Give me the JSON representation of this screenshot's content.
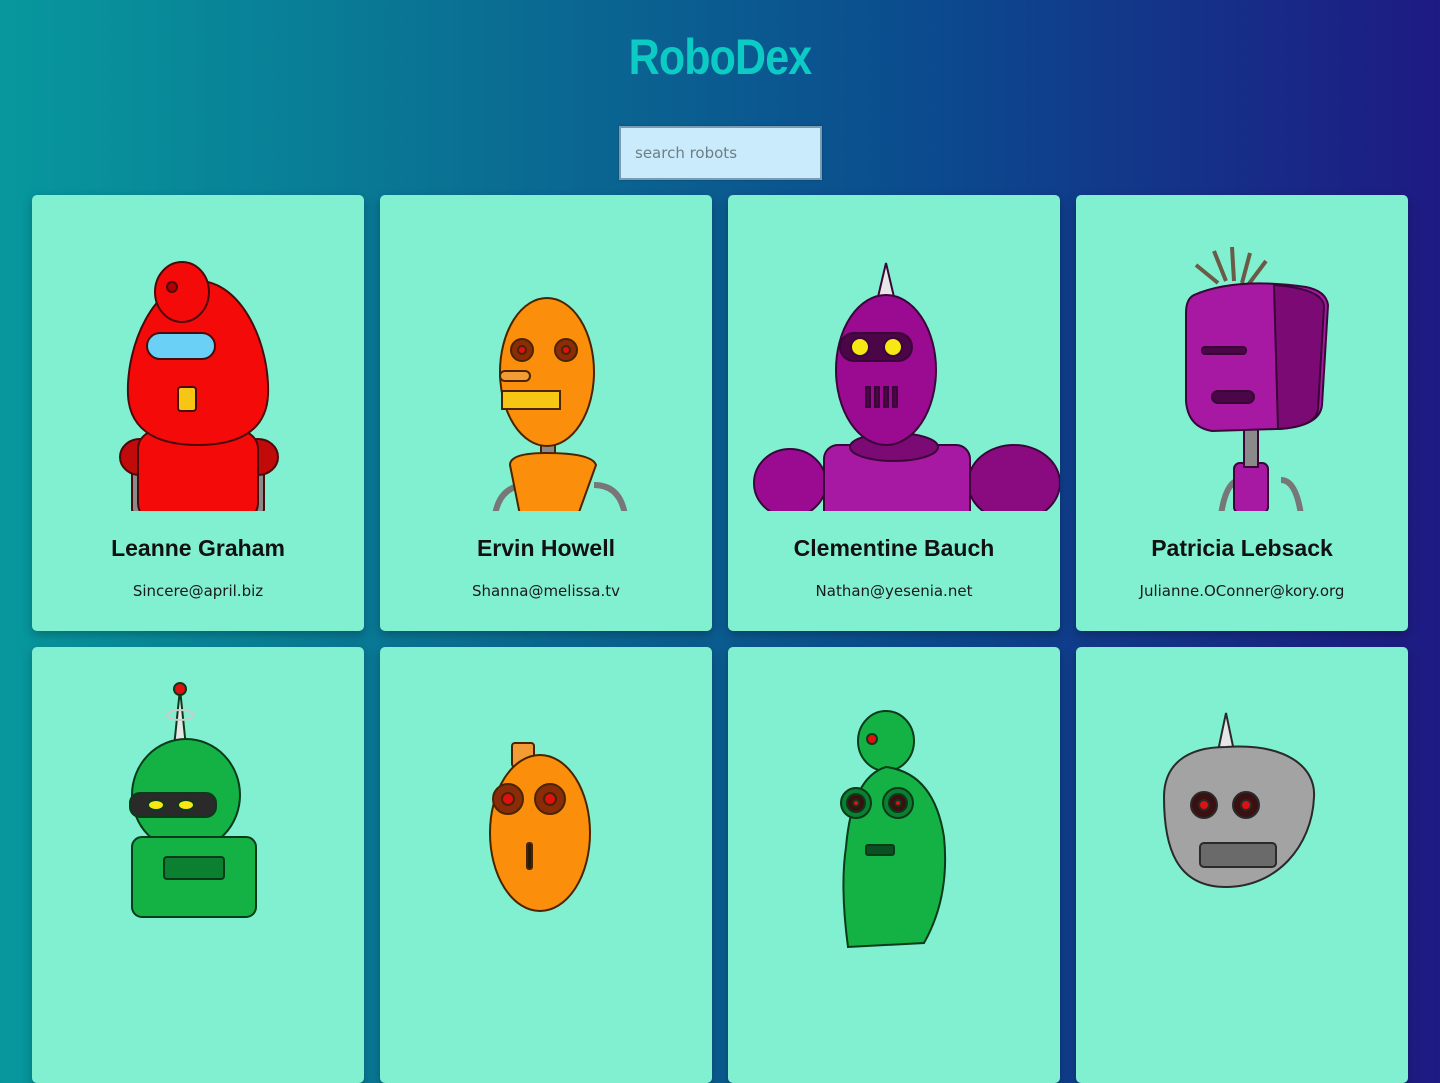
{
  "app": {
    "title": "RoboDex"
  },
  "search": {
    "placeholder": "search robots",
    "value": ""
  },
  "robots": [
    {
      "name": "Leanne Graham",
      "email": "Sincere@april.biz",
      "color": "#f50a0a"
    },
    {
      "name": "Ervin Howell",
      "email": "Shanna@melissa.tv",
      "color": "#fb8f0c"
    },
    {
      "name": "Clementine Bauch",
      "email": "Nathan@yesenia.net",
      "color": "#9b0b91"
    },
    {
      "name": "Patricia Lebsack",
      "email": "Julianne.OConner@kory.org",
      "color": "#a719a3"
    },
    {
      "name": "",
      "email": "",
      "color": "#14b144"
    },
    {
      "name": "",
      "email": "",
      "color": "#fb8f0c"
    },
    {
      "name": "",
      "email": "",
      "color": "#14b144"
    },
    {
      "name": "",
      "email": "",
      "color": "#a3a3a3"
    }
  ]
}
